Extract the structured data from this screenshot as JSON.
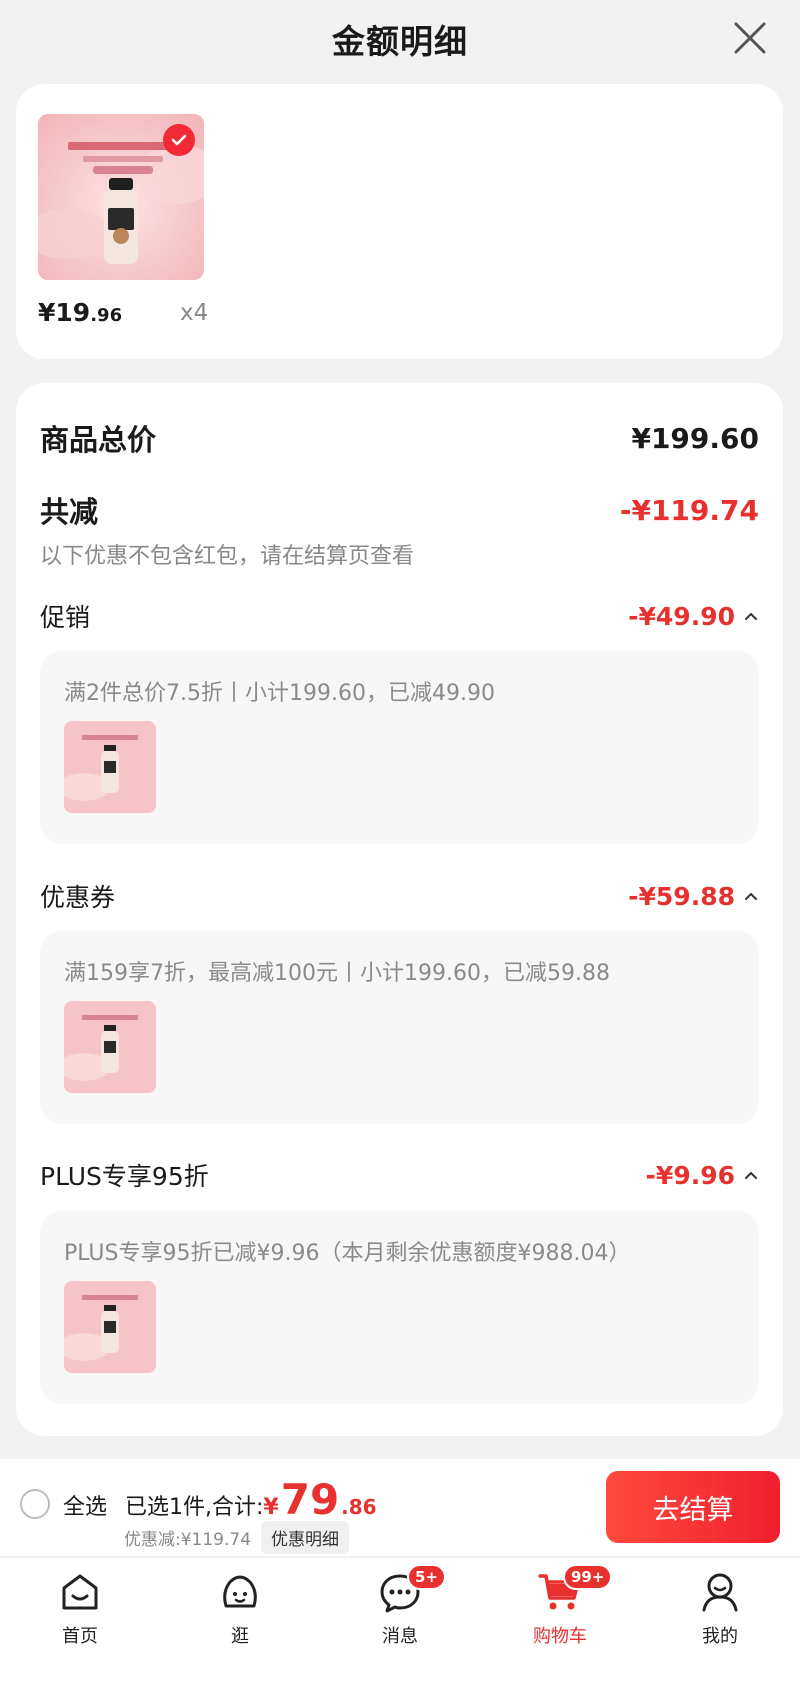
{
  "header": {
    "title": "金额明细"
  },
  "product": {
    "currency": "¥",
    "price_int": "19",
    "price_dec": ".96",
    "qty": "x4"
  },
  "summary": {
    "total_label": "商品总价",
    "total_value": "¥199.60",
    "reduce_label": "共减",
    "reduce_value": "-¥119.74",
    "note": "以下优惠不包含红包，请在结算页查看"
  },
  "discounts": [
    {
      "label": "促销",
      "amount": "-¥49.90",
      "desc": "满2件总价7.5折丨小计199.60，已减49.90"
    },
    {
      "label": "优惠券",
      "amount": "-¥59.88",
      "desc": "满159享7折，最高减100元丨小计199.60，已减59.88"
    },
    {
      "label": "PLUS专享95折",
      "amount": "-¥9.96",
      "desc": "PLUS专享95折已减¥9.96（本月剩余优惠额度¥988.04）"
    }
  ],
  "bottom": {
    "select_all": "全选",
    "selected_text": "已选1件,合计:",
    "currency": "¥",
    "total_int": "79",
    "total_dec": ".86",
    "discount_text": "优惠减:¥119.74",
    "discount_detail_btn": "优惠明细",
    "checkout": "去结算"
  },
  "tabs": [
    {
      "label": "首页",
      "icon": "home-icon"
    },
    {
      "label": "逛",
      "icon": "browse-icon"
    },
    {
      "label": "消息",
      "icon": "message-icon",
      "badge": "5+"
    },
    {
      "label": "购物车",
      "icon": "cart-icon",
      "badge": "99+",
      "active": true
    },
    {
      "label": "我的",
      "icon": "profile-icon"
    }
  ],
  "colors": {
    "accent": "#e8302e",
    "page_bg": "#f2f2f2",
    "card_bg": "#ffffff"
  }
}
